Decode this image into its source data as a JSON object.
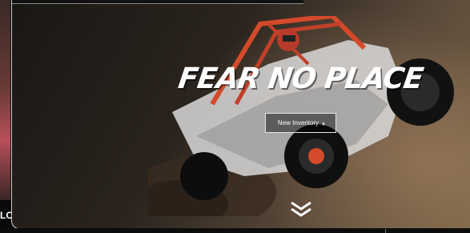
{
  "hero": {
    "headline": "FEAR NO PLACE",
    "cta_label": "New Inventory",
    "cta_icon": "double-chevron-right-icon",
    "scroll_icon": "double-chevron-down-icon"
  },
  "previous_slide": {
    "caption": "LO"
  },
  "colors": {
    "accent_vehicle": "#d44a2a",
    "cta_border": "#e6e6e6",
    "text": "#ffffff"
  }
}
